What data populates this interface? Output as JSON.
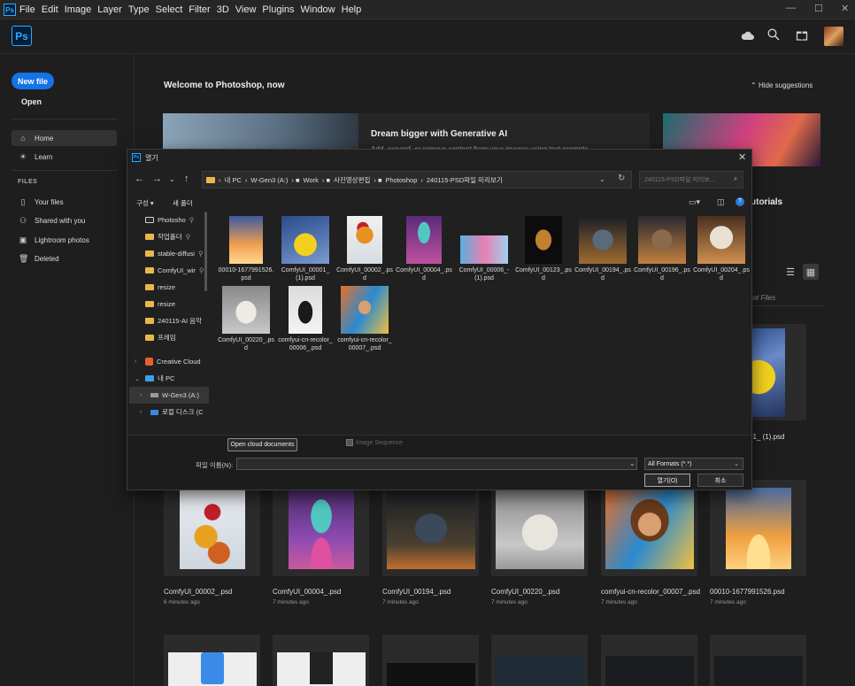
{
  "menubar": {
    "app_icon": "Ps",
    "items": [
      "File",
      "Edit",
      "Image",
      "Layer",
      "Type",
      "Select",
      "Filter",
      "3D",
      "View",
      "Plugins",
      "Window",
      "Help"
    ]
  },
  "topbar": {
    "logo": "Ps",
    "icons": [
      "cloud-icon",
      "search-icon",
      "gift-icon",
      "avatar"
    ]
  },
  "sidebar": {
    "new_file": "New file",
    "open": "Open",
    "nav": [
      {
        "label": "Home",
        "icon": "home-icon"
      },
      {
        "label": "Learn",
        "icon": "lightbulb-icon"
      }
    ],
    "files_header": "FILES",
    "files": [
      {
        "label": "Your files",
        "icon": "file-icon"
      },
      {
        "label": "Shared with you",
        "icon": "people-icon"
      },
      {
        "label": "Lightroom photos",
        "icon": "lightroom-icon"
      },
      {
        "label": "Deleted",
        "icon": "trash-icon"
      }
    ]
  },
  "main": {
    "welcome": "Welcome to Photoshop, now",
    "hide_suggestions": "Hide suggestions",
    "promo_title": "Dream bigger with Generative AI",
    "promo_sub": "Add, expand, or remove content from your images using text prompts.",
    "tutorials": "utorials",
    "recent_label": "ent Files",
    "partial_card": "01_ (1).psd",
    "recent": [
      {
        "name": "ComfyUI_00002_.psd",
        "time": "6 minutes ago"
      },
      {
        "name": "ComfyUI_00004_.psd",
        "time": "7 minutes ago"
      },
      {
        "name": "ComfyUI_00194_.psd",
        "time": "7 minutes ago"
      },
      {
        "name": "ComfyUI_00220_.psd",
        "time": "7 minutes ago"
      },
      {
        "name": "comfyui-cn-recolor_00007_.psd",
        "time": "7 minutes ago"
      },
      {
        "name": "00010-1677991526.psd",
        "time": "7 minutes ago"
      }
    ]
  },
  "dialog": {
    "title": "열기",
    "path": [
      "내 PC",
      "W-Gen3 (A:)",
      "Work",
      "사진영상편집",
      "Photoshop",
      "240115-PSD파일 미리보기"
    ],
    "search_placeholder": "240115-PSD파일 미리보...",
    "organize": "구성 ▾",
    "new_folder": "새 폴더",
    "tree": [
      {
        "label": "Photosho",
        "pin": true,
        "type": "folder-dark"
      },
      {
        "label": "작업폴더",
        "pin": true,
        "type": "folder"
      },
      {
        "label": "stable-diffusi",
        "pin": true,
        "type": "folder"
      },
      {
        "label": "ComfyUI_wir",
        "pin": true,
        "type": "folder"
      },
      {
        "label": "resize",
        "pin": false,
        "type": "folder"
      },
      {
        "label": "resize",
        "pin": false,
        "type": "folder"
      },
      {
        "label": "240115-AI 음악",
        "pin": false,
        "type": "folder"
      },
      {
        "label": "프레임",
        "pin": false,
        "type": "folder"
      }
    ],
    "tree2": [
      {
        "label": "Creative Cloud",
        "arrow": ">"
      },
      {
        "label": "내 PC",
        "arrow": "v"
      },
      {
        "label": "W-Gen3 (A:)",
        "arrow": ">"
      },
      {
        "label": "로컬 디스크 (C",
        "arrow": ">"
      }
    ],
    "files": [
      "00010-1677991526.psd",
      "ComfyUI_00001_(1).psd",
      "ComfyUI_00002_.psd",
      "ComfyUI_00004_.psd",
      "ComfyUI_00006_-(1).psd",
      "ComfyUI_00123_.psd",
      "ComfyUI_00194_.psd",
      "ComfyUI_00196_.psd",
      "ComfyUI_00204_.psd",
      "ComfyUI_00220_.psd",
      "comfyui-cn-recolor_00006_.psd",
      "comfyui-cn-recolor_00007_.psd"
    ],
    "open_cloud": "Open cloud documents",
    "image_sequence": "Image Sequence",
    "filename_label": "파일 이름(N):",
    "filename_value": "",
    "format": "All Formats (*.*)",
    "ok": "열기(O)",
    "cancel": "취소"
  }
}
